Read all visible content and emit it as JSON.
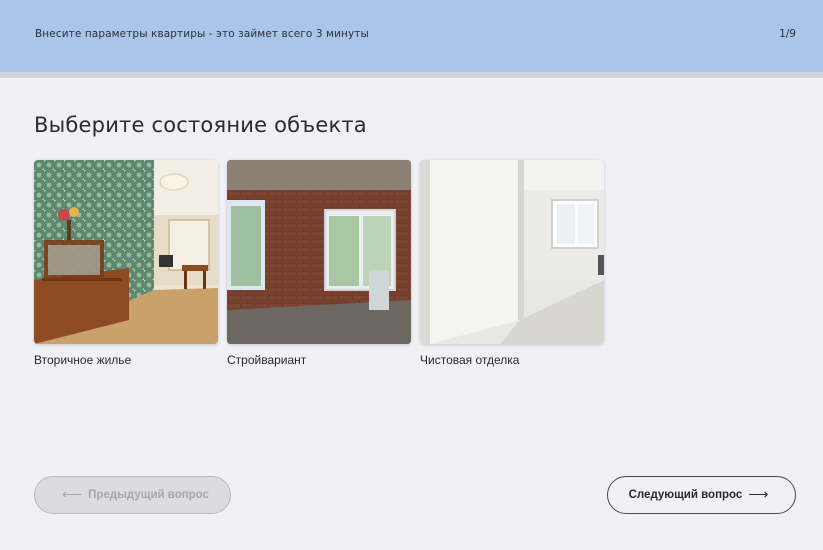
{
  "header": {
    "hint": "Внесите параметры квартиры - это займет всего 3 минуты",
    "counter": "1/9"
  },
  "question": {
    "title": "Выберите состояние объекта"
  },
  "options": [
    {
      "label": "Вторичное жилье"
    },
    {
      "label": "Стройвариант"
    },
    {
      "label": "Чистовая отделка"
    }
  ],
  "nav": {
    "prev_label": "Предыдущий вопрос",
    "next_label": "Следующий вопрос",
    "prev_arrow": "⟵",
    "next_arrow": "⟶"
  }
}
